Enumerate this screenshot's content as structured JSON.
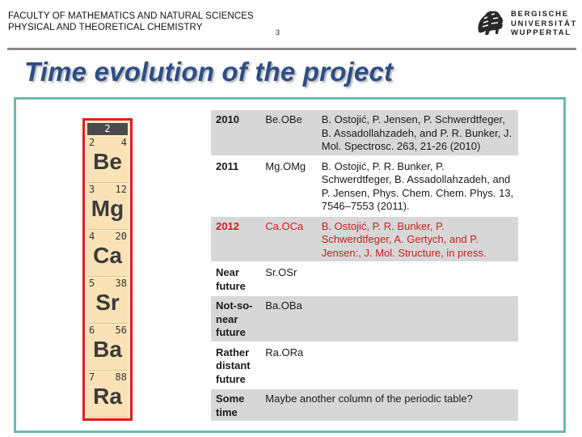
{
  "header": {
    "line1": "FACULTY OF MATHEMATICS AND NATURAL SCIENCES",
    "line2": "PHYSICAL AND THEORETICAL CHEMISTRY",
    "page_number": "3"
  },
  "logo": {
    "lines": [
      "BERGISCHE",
      "UNIVERSITÄT",
      "WUPPERTAL"
    ],
    "icon": "lion-crest-icon"
  },
  "title": "Time evolution of the project",
  "periodic_column": {
    "group": "2",
    "elements": [
      {
        "z": "4",
        "symbol": "Be",
        "mass": "2"
      },
      {
        "z": "12",
        "symbol": "Mg",
        "mass": "3"
      },
      {
        "z": "20",
        "symbol": "Ca",
        "mass": "4"
      },
      {
        "z": "38",
        "symbol": "Sr",
        "mass": "5"
      },
      {
        "z": "56",
        "symbol": "Ba",
        "mass": "6"
      },
      {
        "z": "88",
        "symbol": "Ra",
        "mass": "7"
      }
    ]
  },
  "timeline": [
    {
      "when": "2010",
      "molecule": "Be.OBe",
      "refs": "B. Ostojić, P. Jensen, P. Schwerdtfeger, B. Assadollahzadeh, and P. R. Bunker, J. Mol. Spectrosc. 263, 21-26 (2010)"
    },
    {
      "when": "2011",
      "molecule": "Mg.OMg",
      "refs": "B. Ostojić, P. R. Bunker, P. Schwerdtfeger, B. Assadollahzadeh, and P. Jensen, Phys. Chem. Chem. Phys. 13, 7546–7553 (2011)."
    },
    {
      "when": "2012",
      "molecule": "Ca.OCa",
      "refs": "B. Ostojić, P. R. Bunker, P. Schwerdtfeger, A. Gertych, and P. Jensen:, J. Mol. Structure, in press."
    },
    {
      "when": "Near future",
      "molecule": "Sr.OSr",
      "refs": ""
    },
    {
      "when": "Not-so-near future",
      "molecule": "Ba.OBa",
      "refs": ""
    },
    {
      "when": "Rather distant future",
      "molecule": "Ra.ORa",
      "refs": ""
    },
    {
      "when": "Some time",
      "molecule": "Maybe another column of the periodic table?",
      "refs": ""
    }
  ],
  "colors": {
    "title": "#2e4e86",
    "accent_box": "#6db9b0",
    "highlight": "#cc1f1f",
    "row_shade": "#d7d7d7"
  }
}
